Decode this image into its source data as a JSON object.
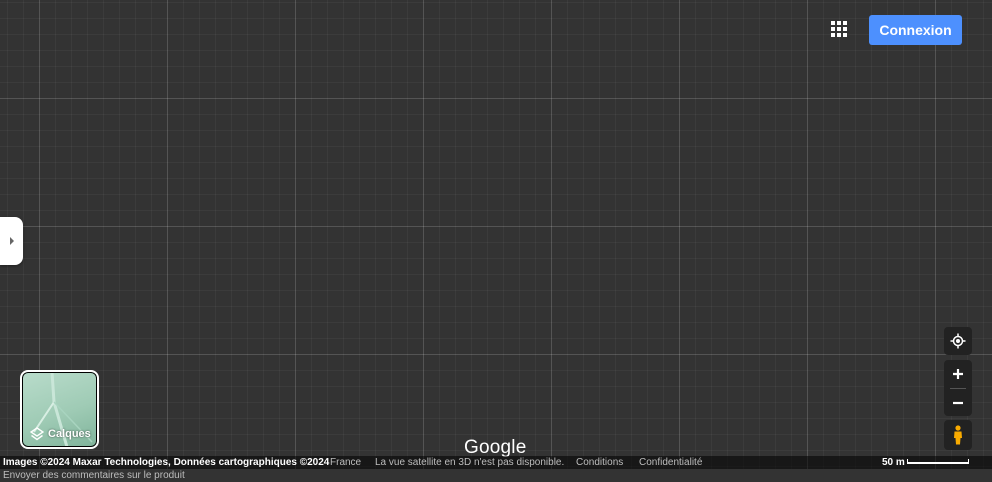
{
  "header": {
    "signin_label": "Connexion"
  },
  "icons": {
    "apps": "apps-grid-icon",
    "panel_toggle": "chevron-right-icon",
    "layers": "layers-icon",
    "locate": "my-location-icon",
    "zoom_in": "plus-icon",
    "zoom_out": "minus-icon",
    "pegman": "pegman-icon"
  },
  "layers_button": {
    "label": "Calques"
  },
  "map": {
    "logo": "Google",
    "background_color": "#333333"
  },
  "footer": {
    "attribution": "Images ©2024 Maxar Technologies, Données cartographiques ©2024",
    "region": "France",
    "notice": "La vue satellite en 3D n'est pas disponible.",
    "terms": "Conditions",
    "privacy": "Confidentialité",
    "scale_label": "50 m",
    "feedback": "Envoyer des commentaires sur le produit"
  },
  "colors": {
    "accent": "#4d90fe",
    "pegman": "#f9ab00"
  }
}
